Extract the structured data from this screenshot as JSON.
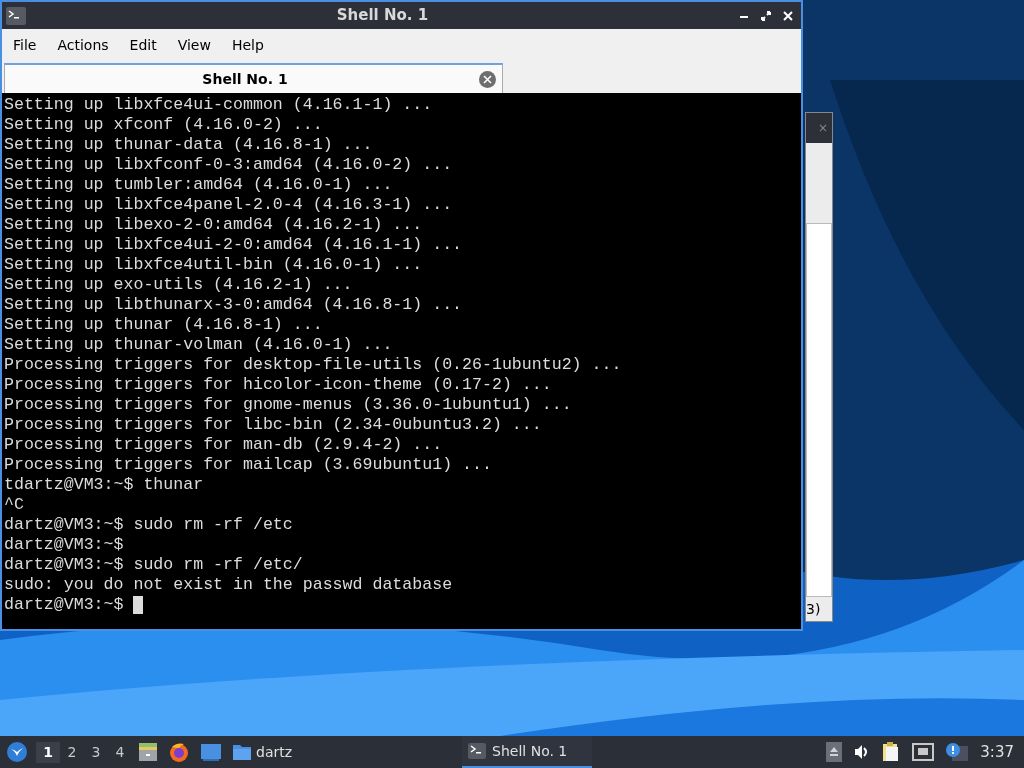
{
  "background_window": {
    "fragment_text": "3)",
    "close_glyph": "×"
  },
  "window": {
    "title": "Shell No. 1",
    "controls": [
      {
        "kind": "minimize"
      },
      {
        "kind": "maximize"
      },
      {
        "kind": "close"
      }
    ]
  },
  "menu": [
    "File",
    "Actions",
    "Edit",
    "View",
    "Help"
  ],
  "tabs": [
    {
      "label": "Shell No. 1",
      "selected": true
    }
  ],
  "terminal": {
    "lines": [
      "Setting up libxfce4ui-common (4.16.1-1) ...",
      "Setting up xfconf (4.16.0-2) ...",
      "Setting up thunar-data (4.16.8-1) ...",
      "Setting up libxfconf-0-3:amd64 (4.16.0-2) ...",
      "Setting up tumbler:amd64 (4.16.0-1) ...",
      "Setting up libxfce4panel-2.0-4 (4.16.3-1) ...",
      "Setting up libexo-2-0:amd64 (4.16.2-1) ...",
      "Setting up libxfce4ui-2-0:amd64 (4.16.1-1) ...",
      "Setting up libxfce4util-bin (4.16.0-1) ...",
      "Setting up exo-utils (4.16.2-1) ...",
      "Setting up libthunarx-3-0:amd64 (4.16.8-1) ...",
      "Setting up thunar (4.16.8-1) ...",
      "Setting up thunar-volman (4.16.0-1) ...",
      "Processing triggers for desktop-file-utils (0.26-1ubuntu2) ...",
      "Processing triggers for hicolor-icon-theme (0.17-2) ...",
      "Processing triggers for gnome-menus (3.36.0-1ubuntu1) ...",
      "Processing triggers for libc-bin (2.34-0ubuntu3.2) ...",
      "Processing triggers for man-db (2.9.4-2) ...",
      "Processing triggers for mailcap (3.69ubuntu1) ...",
      "tdartz@VM3:~$ thunar",
      "^C",
      "dartz@VM3:~$ sudo rm -rf /etc",
      "dartz@VM3:~$",
      "dartz@VM3:~$ sudo rm -rf /etc/",
      "sudo: you do not exist in the passwd database"
    ],
    "prompt": "dartz@VM3:~$"
  },
  "taskbar": {
    "workspaces": [
      {
        "label": "1",
        "selected": true
      },
      {
        "label": "2",
        "selected": false
      },
      {
        "label": "3",
        "selected": false
      },
      {
        "label": "4",
        "selected": false
      }
    ],
    "launchers": [
      {
        "kind": "files"
      },
      {
        "kind": "browser"
      },
      {
        "kind": "desktop"
      }
    ],
    "folder_label": "dartz",
    "task": {
      "label": "Shell No. 1",
      "selected": true
    },
    "tray": [
      {
        "kind": "eject"
      },
      {
        "kind": "volume"
      },
      {
        "kind": "clipboard"
      },
      {
        "kind": "network"
      },
      {
        "kind": "notification"
      }
    ],
    "clock": "3:37"
  }
}
